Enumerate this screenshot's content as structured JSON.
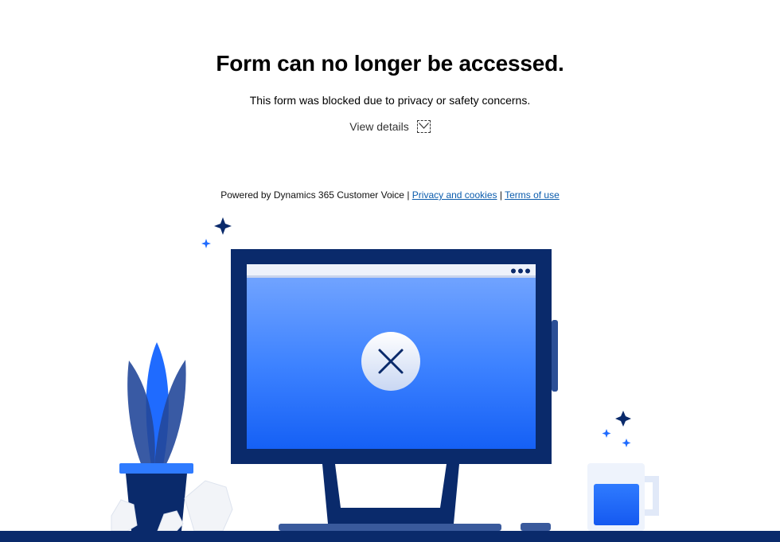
{
  "main": {
    "title": "Form can no longer be accessed.",
    "message": "This form was blocked due to privacy or safety concerns.",
    "details_label": "View details"
  },
  "footer": {
    "powered_by": "Powered by Dynamics 365 Customer Voice",
    "separator": "|",
    "privacy_link": "Privacy and cookies",
    "terms_link": "Terms of use"
  },
  "colors": {
    "navy": "#0a2a6b",
    "blue": "#1f6bff",
    "link": "#0b5cad"
  },
  "icons": {
    "details_toggle": "chevron-down-icon",
    "screen_status": "close-icon"
  }
}
